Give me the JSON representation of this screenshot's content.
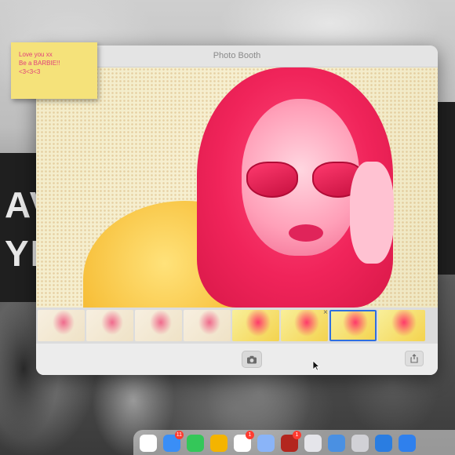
{
  "window": {
    "title": "Photo Booth"
  },
  "sticky_note": {
    "lines": [
      "Love you xx",
      "Be a BARBIE!!",
      "<3<3<3"
    ]
  },
  "background": {
    "banner_text": [
      "AV",
      "YIL"
    ]
  },
  "thumbnails": [
    {
      "label": "photo-1",
      "tone": "neutral"
    },
    {
      "label": "photo-2",
      "tone": "neutral"
    },
    {
      "label": "photo-3",
      "tone": "neutral"
    },
    {
      "label": "photo-4",
      "tone": "neutral"
    },
    {
      "label": "photo-5",
      "tone": "warm"
    },
    {
      "label": "photo-6",
      "tone": "warm"
    },
    {
      "label": "photo-7",
      "tone": "warm",
      "selected": true
    },
    {
      "label": "photo-8",
      "tone": "warm"
    }
  ],
  "dock": {
    "icons": [
      {
        "name": "photos-icon",
        "color": "#ffffff",
        "badge": ""
      },
      {
        "name": "mail-icon",
        "color": "#3a8ef6",
        "badge": "11"
      },
      {
        "name": "facetime-icon",
        "color": "#34c759",
        "badge": ""
      },
      {
        "name": "chrome-icon",
        "color": "#f4b400",
        "badge": ""
      },
      {
        "name": "photos-flower-icon",
        "color": "#ffffff",
        "badge": "1"
      },
      {
        "name": "preview-icon",
        "color": "#8ab4f8",
        "badge": ""
      },
      {
        "name": "photo-booth-icon",
        "color": "#b3261e",
        "badge": "1"
      },
      {
        "name": "launchpad-icon",
        "color": "#e5e5ea",
        "badge": ""
      },
      {
        "name": "finder-icon",
        "color": "#4a90e2",
        "badge": ""
      },
      {
        "name": "preview-viewer-icon",
        "color": "#d1d1d6",
        "badge": ""
      },
      {
        "name": "roblox-icon",
        "color": "#2a7de1",
        "badge": ""
      },
      {
        "name": "app-store-icon",
        "color": "#2f80ed",
        "badge": ""
      }
    ]
  },
  "colors": {
    "sticky_text": "#e0407a",
    "sticky_bg": "#f5e27a",
    "selection": "#2f6fe0"
  }
}
